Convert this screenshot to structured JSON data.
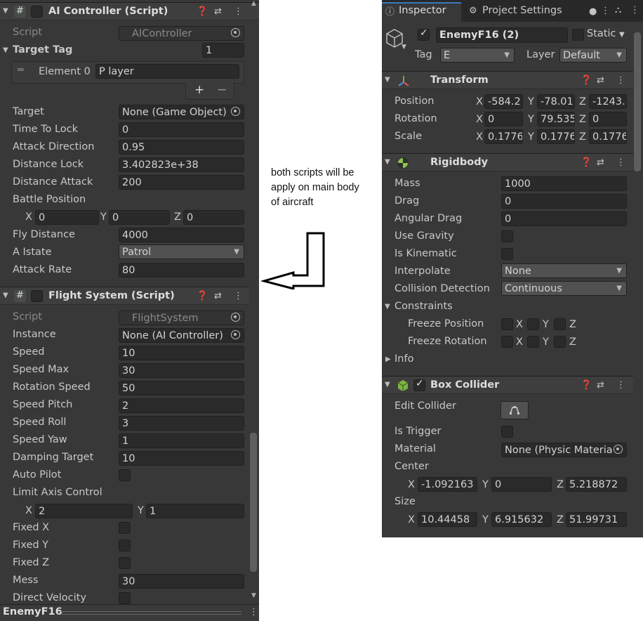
{
  "annotation": {
    "note": "both scripts will be apply on main body of aircraft"
  },
  "left_panel": {
    "ai_controller": {
      "title": "AI Controller (Script)",
      "icons": [
        "script-hash-icon",
        "help-icon",
        "preset-icon",
        "kebab-menu-icon"
      ],
      "script_label": "Script",
      "script_value": "AIController",
      "target_tag_label": "Target Tag",
      "target_tag_count": "1",
      "element0_label": "Element 0",
      "element0_value": "P layer",
      "plus": "+",
      "minus": "−",
      "fields": [
        {
          "label": "Target",
          "value": "None (Game Object)"
        },
        {
          "label": "Time To Lock",
          "value": "0"
        },
        {
          "label": "Attack Direction",
          "value": "0.95"
        },
        {
          "label": "Distance Lock",
          "value": "3.402823e+38"
        },
        {
          "label": "Distance Attack",
          "value": "200"
        }
      ],
      "battle_position_label": "Battle Position",
      "battle_position": {
        "x": "0",
        "y": "0",
        "z": "0"
      },
      "fly_distance_label": "Fly Distance",
      "fly_distance": "4000",
      "a_istate_label": "A Istate",
      "a_istate": "Patrol",
      "attack_rate_label": "Attack Rate",
      "attack_rate": "80"
    },
    "flight_system": {
      "title": "Flight System (Script)",
      "script_label": "Script",
      "script_value": "FlightSystem",
      "instance_label": "Instance",
      "instance_value": "None (AI Controller)",
      "fields": [
        {
          "label": "Speed",
          "value": "10"
        },
        {
          "label": "Speed Max",
          "value": "30"
        },
        {
          "label": "Rotation Speed",
          "value": "50"
        },
        {
          "label": "Speed Pitch",
          "value": "2"
        },
        {
          "label": "Speed Roll",
          "value": "3"
        },
        {
          "label": "Speed Yaw",
          "value": "1"
        },
        {
          "label": "Damping Target",
          "value": "10"
        }
      ],
      "auto_pilot_label": "Auto Pilot",
      "limit_axis_label": "Limit Axis Control",
      "limit_axis": {
        "x": "2",
        "y": "1"
      },
      "fixed_x_label": "Fixed X",
      "fixed_y_label": "Fixed Y",
      "fixed_z_label": "Fixed Z",
      "mess_label": "Mess",
      "mess_value": "30",
      "direct_velocity_label": "Direct Velocity"
    },
    "footer_object": "EnemyF16"
  },
  "right_panel": {
    "tabs": [
      "Inspector",
      "Project Settings"
    ],
    "object_name": "EnemyF16 (2)",
    "static_label": "Static",
    "tag_label": "Tag",
    "tag_value": "E",
    "layer_label": "Layer",
    "layer_value": "Default",
    "transform": {
      "title": "Transform",
      "position_label": "Position",
      "position": {
        "x": "-584.2",
        "y": "-78.01",
        "z": "-1243."
      },
      "rotation_label": "Rotation",
      "rotation": {
        "x": "0",
        "y": "79.535",
        "z": "0"
      },
      "scale_label": "Scale",
      "scale": {
        "x": "0.1776",
        "y": "0.1776",
        "z": "0.1776"
      }
    },
    "rigidbody": {
      "title": "Rigidbody",
      "mass_label": "Mass",
      "mass": "1000",
      "drag_label": "Drag",
      "drag": "0",
      "angular_drag_label": "Angular Drag",
      "angular_drag": "0",
      "use_gravity_label": "Use Gravity",
      "is_kinematic_label": "Is Kinematic",
      "interpolate_label": "Interpolate",
      "interpolate": "None",
      "collision_label": "Collision Detection",
      "collision": "Continuous",
      "constraints_label": "Constraints",
      "freeze_position_label": "Freeze Position",
      "freeze_rotation_label": "Freeze Rotation",
      "info_label": "Info"
    },
    "box_collider": {
      "title": "Box Collider",
      "edit_collider_label": "Edit Collider",
      "is_trigger_label": "Is Trigger",
      "material_label": "Material",
      "material_value": "None (Physic Materia",
      "center_label": "Center",
      "center": {
        "x": "-1.092163",
        "y": "0",
        "z": "5.218872"
      },
      "size_label": "Size",
      "size": {
        "x": "10.44458",
        "y": "6.915632",
        "z": "51.99731"
      }
    },
    "axis": {
      "x": "X",
      "y": "Y",
      "z": "Z"
    }
  }
}
